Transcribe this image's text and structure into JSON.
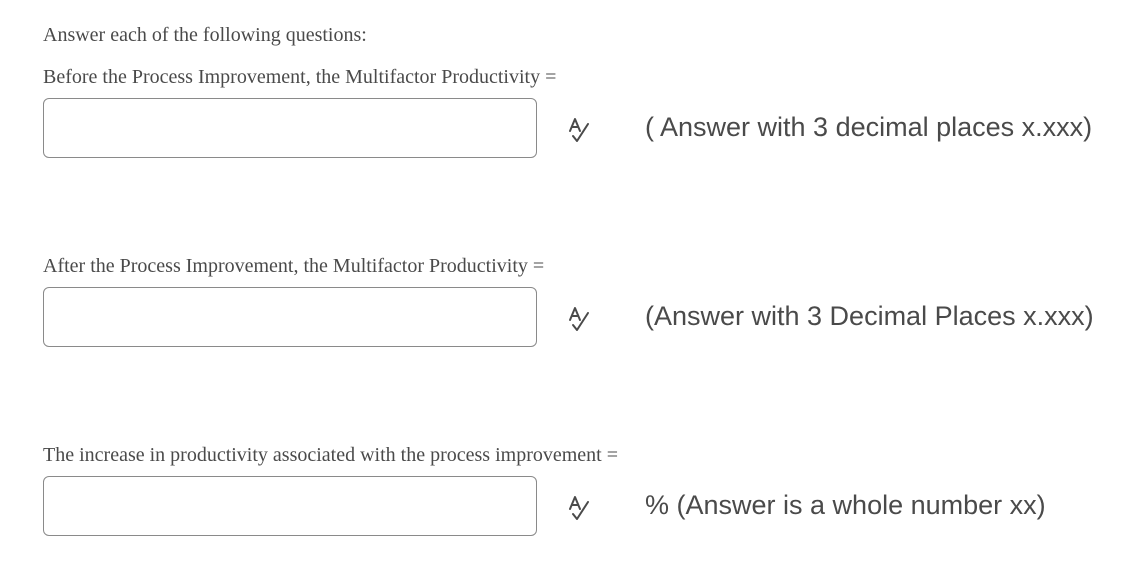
{
  "intro": "Answer each of the following questions:",
  "questions": [
    {
      "label": "Before the Process Improvement, the Multifactor Productivity =",
      "value": "",
      "placeholder": "",
      "icon": "spell-check-icon",
      "hint": "( Answer with 3 decimal places x.xxx)"
    },
    {
      "label": "After the Process Improvement, the Multifactor Productivity =",
      "value": "",
      "placeholder": "",
      "icon": "spell-check-icon",
      "hint": "(Answer with 3 Decimal Places x.xxx)"
    },
    {
      "label": "The increase in productivity associated with the process improvement =",
      "value": "",
      "placeholder": "",
      "icon": "spell-check-icon",
      "hint": "% (Answer is a whole number xx)"
    }
  ],
  "colors": {
    "text": "#4a4a4a",
    "input_border": "#8a8a8a",
    "background": "#ffffff"
  }
}
